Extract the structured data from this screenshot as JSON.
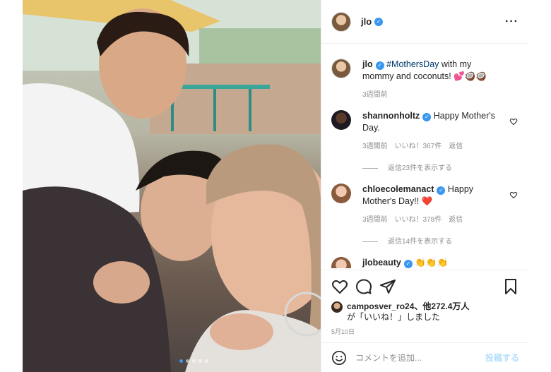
{
  "post": {
    "author": "jlo",
    "more_icon": "more-dots-icon"
  },
  "caption": {
    "user": "jlo",
    "hashtag": "#MothersDay",
    "text": " with my mommy and coconuts! 💕🥥🥥",
    "time": "3週間前"
  },
  "comments": [
    {
      "user": "shannonholtz",
      "text": " Happy Mother's Day.",
      "time": "3週間前",
      "likes": "いいね！367件",
      "reply": "返信",
      "view_replies": "返信23件を表示する"
    },
    {
      "user": "chloecolemanact",
      "text": " Happy Mother's Day!! ❤️",
      "time": "3週間前",
      "likes": "いいね！378件",
      "reply": "返信",
      "view_replies": "返信14件を表示する"
    },
    {
      "user": "jlobeauty",
      "text": " 👏👏👏"
    }
  ],
  "likes": {
    "user": "camposver_ro24",
    "text": "、他272.4万人",
    "text2": "が「いいね！」しました"
  },
  "date": "5月10日",
  "add_comment": {
    "placeholder": "コメントを追加...",
    "post_label": "投稿する"
  },
  "carousel": {
    "current": 1,
    "total": 5,
    "next_icon": "chevron-right-icon"
  },
  "colors": {
    "accent": "#3897f0",
    "text": "#262626",
    "muted": "#8e8e8e",
    "heart": "#ed4956"
  }
}
